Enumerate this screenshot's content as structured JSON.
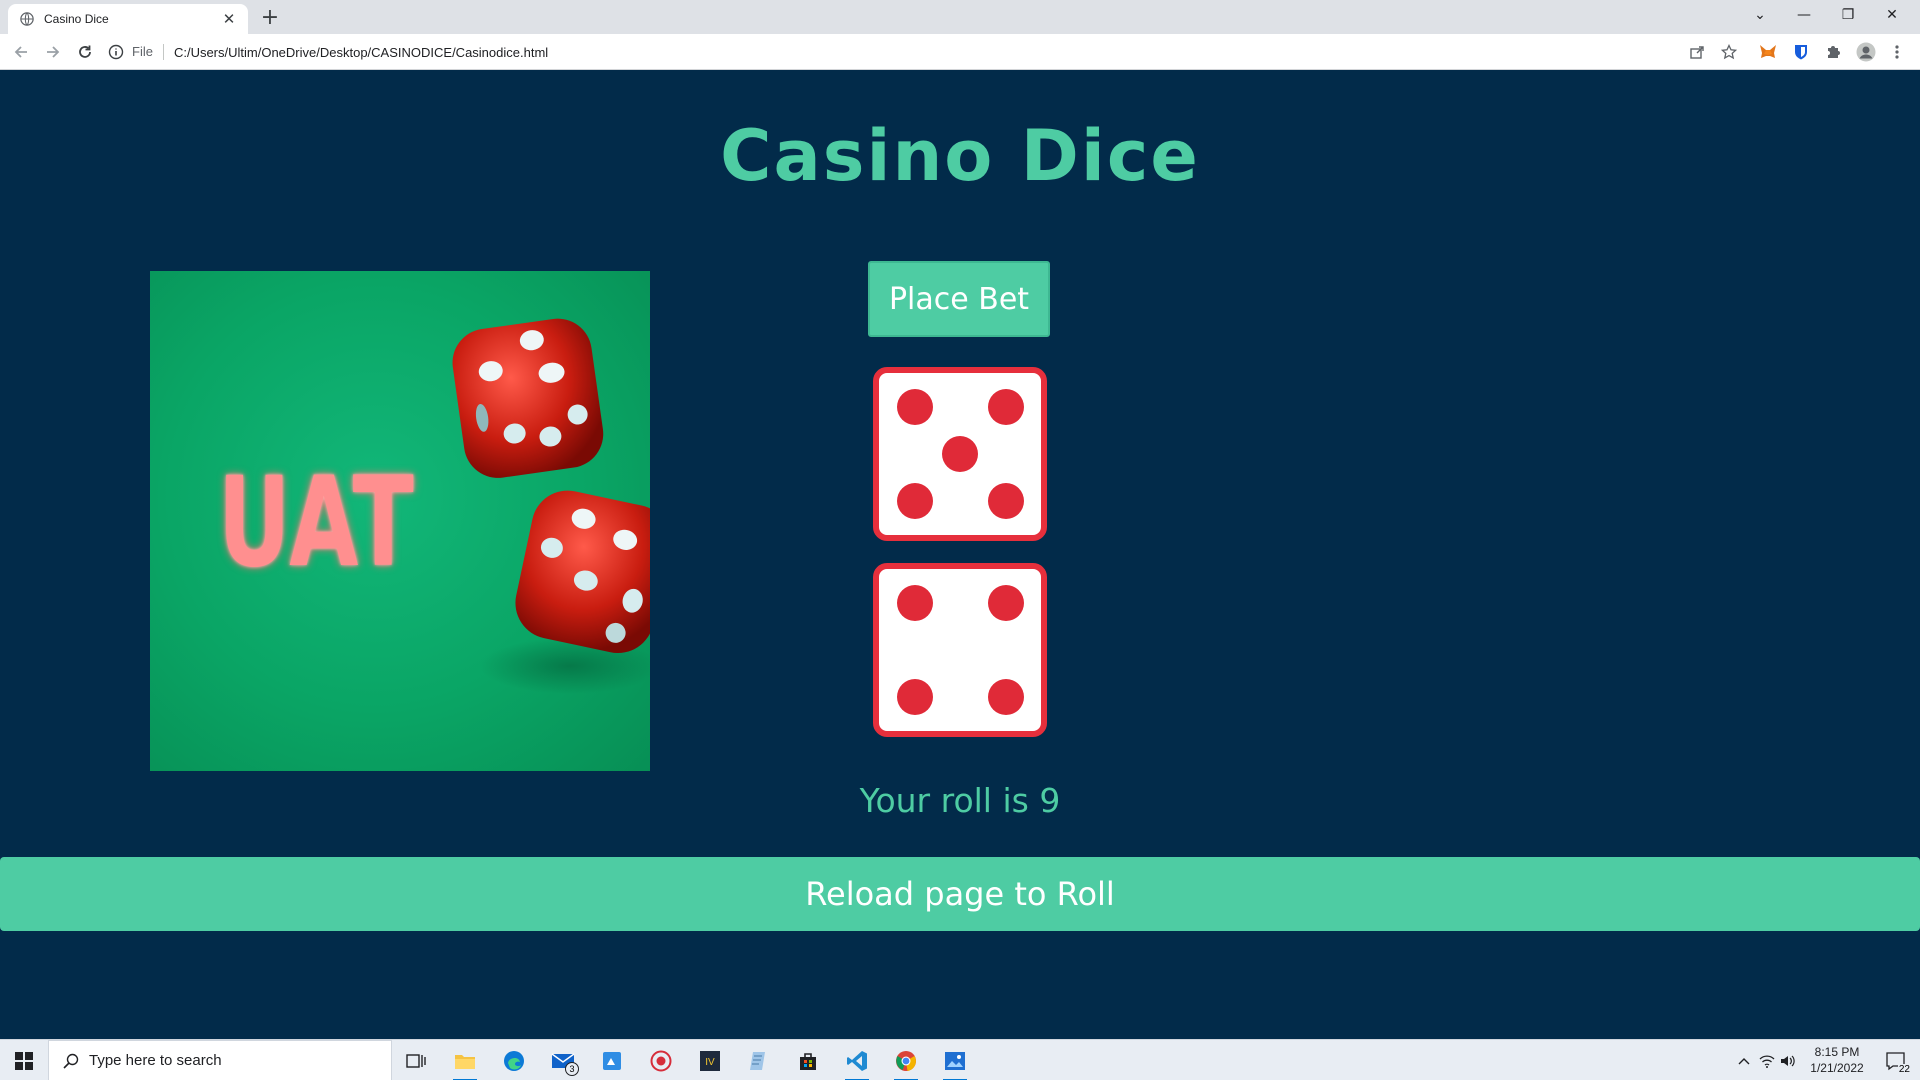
{
  "browser": {
    "tab_title": "Casino Dice",
    "tab_close": "✕",
    "new_tab": "+",
    "address": {
      "scheme_label": "File",
      "url": "C:/Users/Ultim/OneDrive/Desktop/CASINODICE/Casinodice.html"
    },
    "window_controls": [
      "⌄",
      "—",
      "❐",
      "✕"
    ]
  },
  "page": {
    "title": "Casino Dice",
    "promo_image": {
      "brand_text": "UAT",
      "background_color": "#0aa565"
    },
    "bet_button_label": "Place Bet",
    "dice": [
      {
        "face": 5
      },
      {
        "face": 4
      }
    ],
    "roll_result": "Your roll is 9",
    "reload_label": "Reload page to Roll"
  },
  "colors": {
    "page_background": "#022b4a",
    "accent": "#4ecca3",
    "die_red": "#e62f3c"
  },
  "taskbar": {
    "search_placeholder": "Type here to search",
    "apps": [
      "task-view",
      "file-explorer",
      "edge",
      "mail",
      "photos-app",
      "record-app",
      "iv-app",
      "notepad",
      "store",
      "vscode",
      "chrome",
      "photos"
    ],
    "mail_badge": "3",
    "clock": {
      "time": "8:15 PM",
      "date": "1/21/2022"
    },
    "notification_count": "22"
  }
}
